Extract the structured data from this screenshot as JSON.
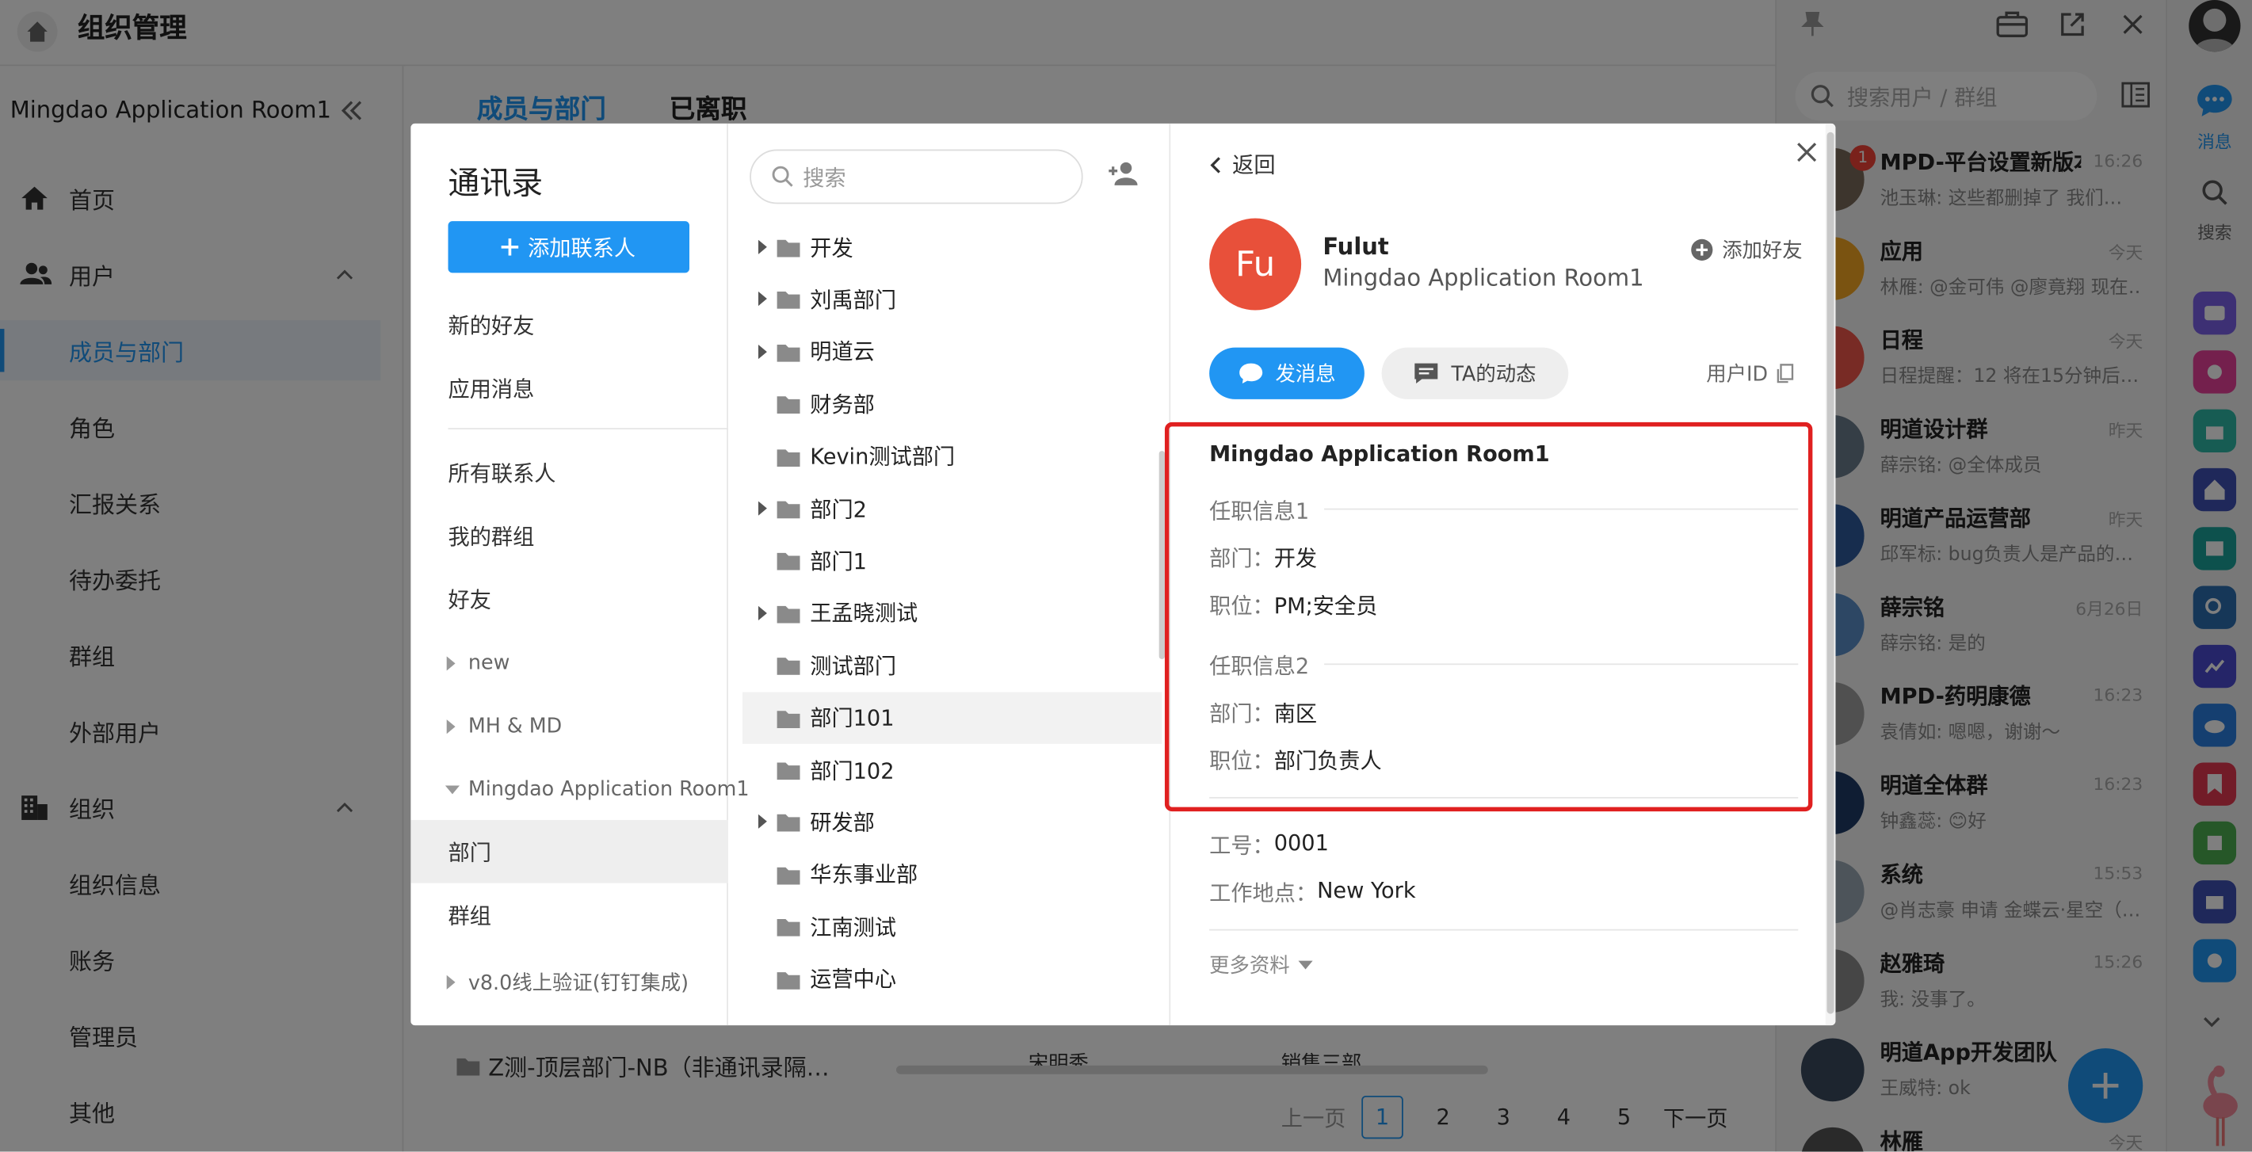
{
  "app": {
    "title": "组织管理"
  },
  "sidebar": {
    "org_name": "Mingdao Application Room1",
    "items": [
      {
        "label": "首页"
      },
      {
        "label": "用户"
      },
      {
        "label": "成员与部门"
      },
      {
        "label": "角色"
      },
      {
        "label": "汇报关系"
      },
      {
        "label": "待办委托"
      },
      {
        "label": "群组"
      },
      {
        "label": "外部用户"
      },
      {
        "label": "组织"
      },
      {
        "label": "组织信息"
      },
      {
        "label": "账务"
      },
      {
        "label": "管理员"
      },
      {
        "label": "其他"
      }
    ]
  },
  "main": {
    "tabs": [
      {
        "label": "成员与部门"
      },
      {
        "label": "已离职"
      }
    ],
    "bg_dept": "Z测-顶层部门-NB（非通讯录隔…",
    "bg_member": "宋明秀",
    "bg_member_dept": "销售三部",
    "pagination": {
      "prev": "上一页",
      "pages": [
        "1",
        "2",
        "3",
        "4",
        "5"
      ],
      "next": "下一页",
      "current": "1"
    }
  },
  "chat": {
    "search_placeholder": "搜索用户 / 群组",
    "conversations": [
      {
        "name": "MPD-平台设置新版本",
        "time": "16:26",
        "preview": "池玉琳: 这些都删掉了 我们…",
        "badge": "1",
        "color": "#7a6a5a"
      },
      {
        "name": "应用",
        "time": "今天",
        "preview": "林雁: @金可伟 @廖竟翔 现在…",
        "color": "#f5a623"
      },
      {
        "name": "日程",
        "time": "今天",
        "preview": "日程提醒：12 将在15分钟后…",
        "color": "#f0574b"
      },
      {
        "name": "明道设计群",
        "time": "昨天",
        "preview": "薛宗铭: @全体成员",
        "color": "#6b7c8c"
      },
      {
        "name": "明道产品运营部",
        "time": "昨天",
        "preview": "邱军标: bug负责人是产品的…",
        "color": "#2e5a9c"
      },
      {
        "name": "薛宗铭",
        "time": "6月26日",
        "preview": "薛宗铭: 是的",
        "color": "#5b8ec9"
      },
      {
        "name": "MPD-药明康德",
        "time": "16:23",
        "preview": "袁倩如: 嗯嗯，谢谢～",
        "color": "#a0a0a0"
      },
      {
        "name": "明道全体群",
        "time": "16:23",
        "preview": "钟鑫蕊: 😊好",
        "color": "#1f3b66"
      },
      {
        "name": "系统",
        "time": "15:53",
        "preview": "@肖志豪 申请 金蝶云·星空（…",
        "color": "#9aa8b5"
      },
      {
        "name": "赵雅琦",
        "time": "15:26",
        "preview": "我: 没事了。",
        "color": "#8c8c8c"
      },
      {
        "name": "明道App开发团队",
        "time": "",
        "preview": "王威特: ok",
        "color": "#3b4a5e"
      },
      {
        "name": "林雁",
        "time": "今天",
        "preview": "",
        "color": "#555"
      }
    ]
  },
  "rail": {
    "messages_label": "消息",
    "search_label": "搜索"
  },
  "modal": {
    "title": "通讯录",
    "add_contact": "添加联系人",
    "nav_top": [
      "新的好友",
      "应用消息"
    ],
    "nav_mid": [
      "所有联系人",
      "我的群组",
      "好友"
    ],
    "groups": [
      "new",
      "MH & MD",
      "Mingdao Application Room1"
    ],
    "sub_items": [
      "部门",
      "群组"
    ],
    "group_last": "v8.0线上验证(钉钉集成)",
    "dept_search_placeholder": "搜索",
    "departments": [
      {
        "name": "开发",
        "expandable": true
      },
      {
        "name": "刘禹部门",
        "expandable": true
      },
      {
        "name": "明道云",
        "expandable": true
      },
      {
        "name": "财务部",
        "expandable": false
      },
      {
        "name": "Kevin测试部门",
        "expandable": false
      },
      {
        "name": "部门2",
        "expandable": true
      },
      {
        "name": "部门1",
        "expandable": false
      },
      {
        "name": "王孟晓测试",
        "expandable": true
      },
      {
        "name": "测试部门",
        "expandable": false
      },
      {
        "name": "部门101",
        "expandable": false
      },
      {
        "name": "部门102",
        "expandable": false
      },
      {
        "name": "研发部",
        "expandable": true
      },
      {
        "name": "华东事业部",
        "expandable": false
      },
      {
        "name": "江南测试",
        "expandable": false
      },
      {
        "name": "运营中心",
        "expandable": false
      }
    ],
    "selected_department": "部门101",
    "profile": {
      "back": "返回",
      "avatar_text": "Fu",
      "name": "Fulut",
      "org": "Mingdao Application Room1",
      "add_friend": "添加好友",
      "send_message": "发消息",
      "feed": "TA的动态",
      "user_id": "用户ID",
      "info_org": "Mingdao Application Room1",
      "sections": [
        {
          "title": "任职信息1",
          "dept_label": "部门：",
          "dept": "开发",
          "pos_label": "职位：",
          "pos": "PM;安全员"
        },
        {
          "title": "任职信息2",
          "dept_label": "部门：",
          "dept": "南区",
          "pos_label": "职位：",
          "pos": "部门负责人"
        }
      ],
      "emp_no_label": "工号：",
      "emp_no": "0001",
      "location_label": "工作地点：",
      "location": "New York",
      "more": "更多资料"
    }
  },
  "colors": {
    "accent": "#2196f3",
    "highlight_border": "#e02020",
    "avatar": "#e8503a"
  }
}
